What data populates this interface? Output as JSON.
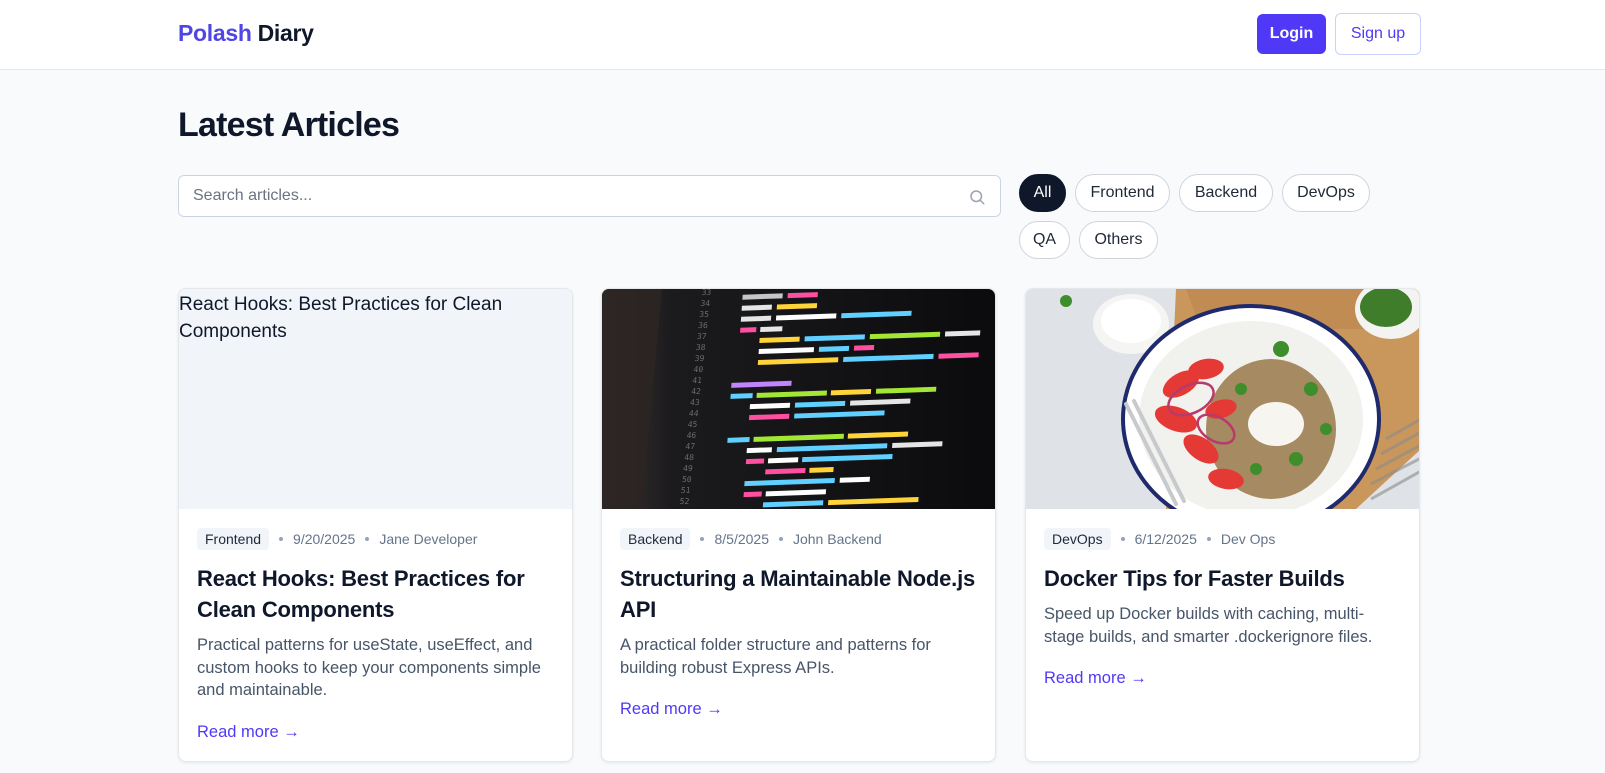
{
  "brand": {
    "part1": "Polash",
    "part2": "Diary"
  },
  "header": {
    "login_label": "Login",
    "signup_label": "Sign up"
  },
  "page": {
    "title": "Latest Articles"
  },
  "search": {
    "placeholder": "Search articles..."
  },
  "filters": [
    {
      "label": "All",
      "active": true
    },
    {
      "label": "Frontend",
      "active": false
    },
    {
      "label": "Backend",
      "active": false
    },
    {
      "label": "DevOps",
      "active": false
    },
    {
      "label": "QA",
      "active": false
    },
    {
      "label": "Others",
      "active": false
    }
  ],
  "articles": [
    {
      "image_alt": "React Hooks: Best Practices for Clean Components",
      "image_state": "broken",
      "category": "Frontend",
      "date": "9/20/2025",
      "author": "Jane Developer",
      "title": "React Hooks: Best Practices for Clean Components",
      "excerpt": "Practical patterns for useState, useEffect, and custom hooks to keep your components simple and maintainable.",
      "read_more": "Read more →"
    },
    {
      "image_alt": "",
      "image_state": "code-screenshot",
      "category": "Backend",
      "date": "8/5/2025",
      "author": "John Backend",
      "title": "Structuring a Maintainable Node.js API",
      "excerpt": "A practical folder structure and patterns for building robust Express APIs.",
      "read_more": "Read more →"
    },
    {
      "image_alt": "",
      "image_state": "food-photo",
      "category": "DevOps",
      "date": "6/12/2025",
      "author": "Dev Ops",
      "title": "Docker Tips for Faster Builds",
      "excerpt": "Speed up Docker builds with caching, multi-stage builds, and smarter .dockerignore files.",
      "read_more": "Read more →"
    }
  ],
  "colors": {
    "accent": "#4f39f6",
    "dark": "#0f172a",
    "muted": "#64748b"
  }
}
